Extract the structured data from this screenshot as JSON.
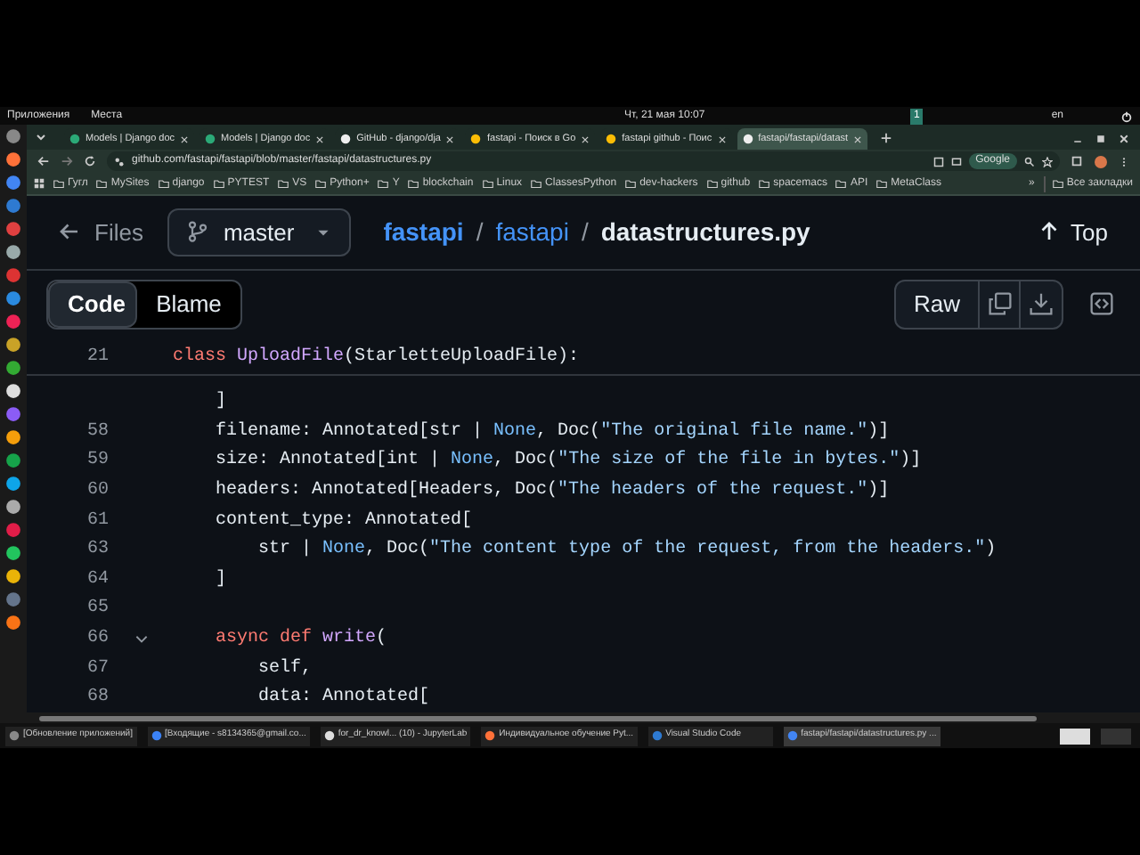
{
  "system_bar": {
    "menus": [
      "Приложения",
      "Места"
    ],
    "clock": "Чт, 21 мая 10:07",
    "workspace": "1",
    "keyboard_layout": "en"
  },
  "browser": {
    "tabs": [
      {
        "title": "Models | Django doc",
        "selected": false
      },
      {
        "title": "Models | Django doc",
        "selected": false
      },
      {
        "title": "GitHub - django/dja",
        "selected": false
      },
      {
        "title": "fastapi - Поиск в Go",
        "selected": false
      },
      {
        "title": "fastapi github - Поис",
        "selected": false
      },
      {
        "title": "fastapi/fastapi/datast",
        "selected": true
      }
    ],
    "url": "github.com/fastapi/fastapi/blob/master/fastapi/datastructures.py",
    "search_chip": "Google",
    "bookmarks": [
      "Гугл",
      "MySites",
      "django",
      "PYTEST",
      "VS",
      "Python+",
      "Y",
      "blockchain",
      "Linux",
      "ClassesPython",
      "dev-hackers",
      "github",
      "spacemacs",
      "API",
      "MetaClass"
    ],
    "bookmarks_more": "»",
    "all_bookmarks": "Все закладки"
  },
  "page": {
    "files_link": "Files",
    "branch": "master",
    "breadcrumb": [
      {
        "text": "fastapi",
        "kind": "link"
      },
      {
        "text": "fastapi",
        "kind": "link"
      },
      {
        "text": "datastructures.py",
        "kind": "current"
      }
    ],
    "separators": [
      "/",
      "/"
    ],
    "top_link": "Top",
    "view_tabs": [
      {
        "label": "Code",
        "selected": true
      },
      {
        "label": "Blame",
        "selected": false
      }
    ],
    "raw_button": "Raw",
    "sticky_line": {
      "number": "21",
      "tokens": [
        {
          "text": "class ",
          "kind": "kw"
        },
        {
          "text": "UploadFile",
          "kind": "fn"
        },
        {
          "text": "(StarletteUploadFile):",
          "kind": "plain"
        }
      ]
    },
    "lines": [
      {
        "foldable": false,
        "tokens": [
          {
            "text": "    ]",
            "kind": "plain"
          }
        ]
      },
      {
        "number": "58",
        "foldable": false,
        "tokens": [
          {
            "text": "    filename: Annotated[str | ",
            "kind": "plain"
          },
          {
            "text": "None",
            "kind": "const"
          },
          {
            "text": ", Doc(",
            "kind": "plain"
          },
          {
            "text": "\"The original file name.\"",
            "kind": "str"
          },
          {
            "text": ")]",
            "kind": "plain"
          }
        ]
      },
      {
        "number": "59",
        "foldable": false,
        "tokens": [
          {
            "text": "    size: Annotated[int | ",
            "kind": "plain"
          },
          {
            "text": "None",
            "kind": "const"
          },
          {
            "text": ", Doc(",
            "kind": "plain"
          },
          {
            "text": "\"The size of the file in bytes.\"",
            "kind": "str"
          },
          {
            "text": ")]",
            "kind": "plain"
          }
        ]
      },
      {
        "number": "60",
        "foldable": false,
        "tokens": [
          {
            "text": "    headers: Annotated[Headers, Doc(",
            "kind": "plain"
          },
          {
            "text": "\"The headers of the request.\"",
            "kind": "str"
          },
          {
            "text": ")]",
            "kind": "plain"
          }
        ]
      },
      {
        "number": "61",
        "foldable": false,
        "tokens": [
          {
            "text": "    content_type: Annotated[",
            "kind": "plain"
          }
        ]
      },
      {
        "number": "63",
        "foldable": false,
        "tokens": [
          {
            "text": "        str | ",
            "kind": "plain"
          },
          {
            "text": "None",
            "kind": "const"
          },
          {
            "text": ", Doc(",
            "kind": "plain"
          },
          {
            "text": "\"The content type of the request, from the headers.\"",
            "kind": "str"
          },
          {
            "text": ")",
            "kind": "plain"
          }
        ]
      },
      {
        "number": "64",
        "foldable": false,
        "tokens": [
          {
            "text": "    ]",
            "kind": "plain"
          }
        ]
      },
      {
        "number": "65",
        "foldable": false
      },
      {
        "number": "66",
        "foldable": true,
        "tokens": [
          {
            "text": "    async def ",
            "kind": "kw"
          },
          {
            "text": "write",
            "kind": "fn"
          },
          {
            "text": "(",
            "kind": "plain"
          }
        ]
      },
      {
        "number": "67",
        "foldable": false,
        "tokens": [
          {
            "text": "        self,",
            "kind": "plain"
          }
        ]
      },
      {
        "number": "68",
        "foldable": false,
        "tokens": [
          {
            "text": "        data: Annotated[",
            "kind": "plain"
          }
        ]
      }
    ]
  },
  "taskbar": [
    {
      "title": "[Обновление приложений]",
      "selected": false
    },
    {
      "title": "[Входящие - s8134365@gmail.co...",
      "selected": false
    },
    {
      "title": "for_dr_knowl... (10) - JupyterLab",
      "selected": false
    },
    {
      "title": "Индивидуальное обучение Pyt...",
      "selected": false
    },
    {
      "title": "Visual Studio Code",
      "selected": false
    },
    {
      "title": "fastapi/fastapi/datastructures.py ...",
      "selected": true
    }
  ]
}
